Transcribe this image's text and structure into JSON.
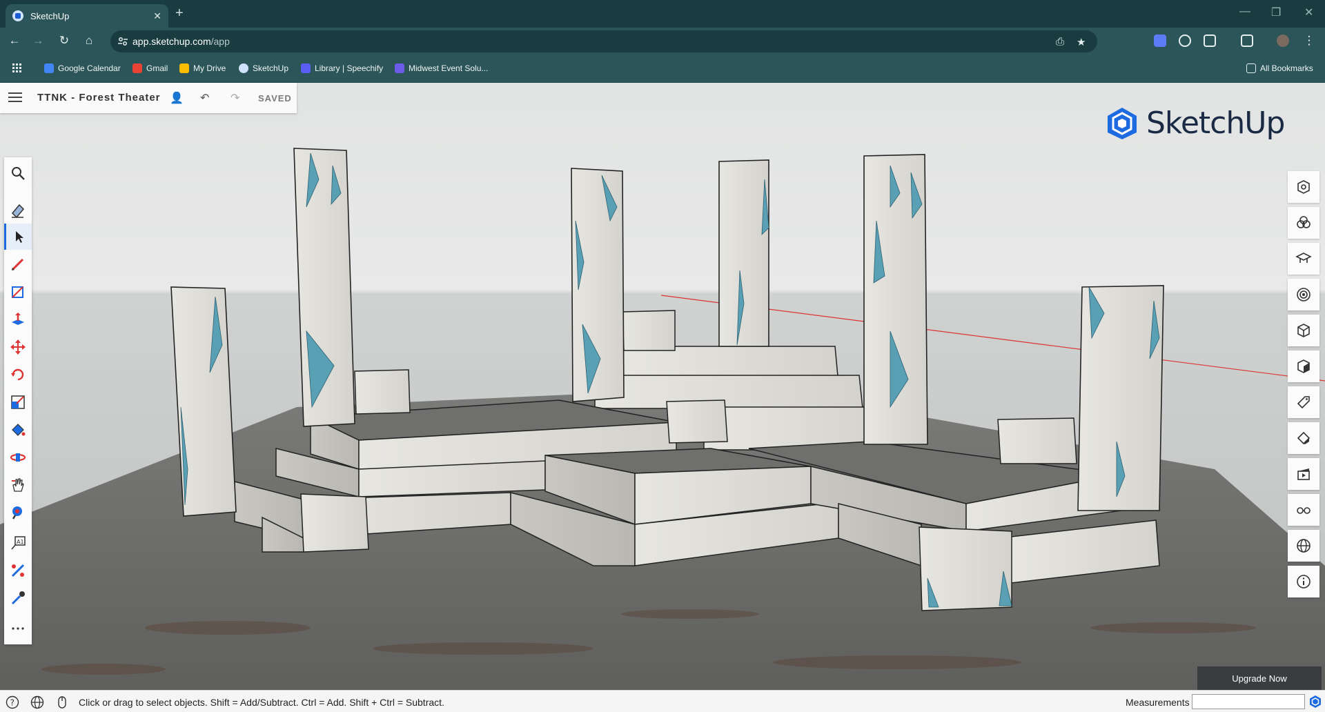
{
  "browser": {
    "tab_title": "SketchUp",
    "tab_close": "✕",
    "new_tab": "+",
    "url_host": "app.sketchup.com",
    "url_path": "/app",
    "bookmarks": [
      {
        "label": "Google Calendar",
        "color": "#4285f4"
      },
      {
        "label": "Gmail",
        "color": "#ea4335"
      },
      {
        "label": "My Drive",
        "color": "#fbbc04"
      },
      {
        "label": "SketchUp",
        "color": "#cfe3ff"
      },
      {
        "label": "Library | Speechify",
        "color": "#5b5ef4"
      },
      {
        "label": "Midwest Event Solu...",
        "color": "#6c5ce7"
      }
    ],
    "all_bookmarks": "All Bookmarks"
  },
  "app": {
    "model_name": "TTNK - Forest Theater",
    "save_state": "SAVED",
    "brand": "SketchUp",
    "upgrade_label": "Upgrade Now",
    "status_message": "Click or drag to select objects. Shift = Add/Subtract. Ctrl = Add. Shift + Ctrl = Subtract.",
    "measurements_label": "Measurements",
    "measurements_value": "",
    "left_tools": [
      "search-icon",
      "eraser-icon",
      "select-arrow-icon",
      "pencil-icon",
      "rectangle-icon",
      "push-pull-icon",
      "move-icon",
      "rotate-icon",
      "scale-icon",
      "paint-bucket-icon",
      "orbit-icon",
      "pan-icon",
      "zoom-extents-icon",
      "text-icon",
      "tape-measure-icon",
      "eyedropper-icon",
      "more-icon"
    ],
    "right_tools": [
      "entity-info-icon",
      "components-icon",
      "instructor-icon",
      "styles-icon",
      "scenes-icon",
      "solid-tools-icon",
      "tags-icon",
      "materials-icon",
      "animation-icon",
      "display-icon",
      "globe-icon",
      "info-icon"
    ],
    "accent": "#1e6ae0"
  }
}
